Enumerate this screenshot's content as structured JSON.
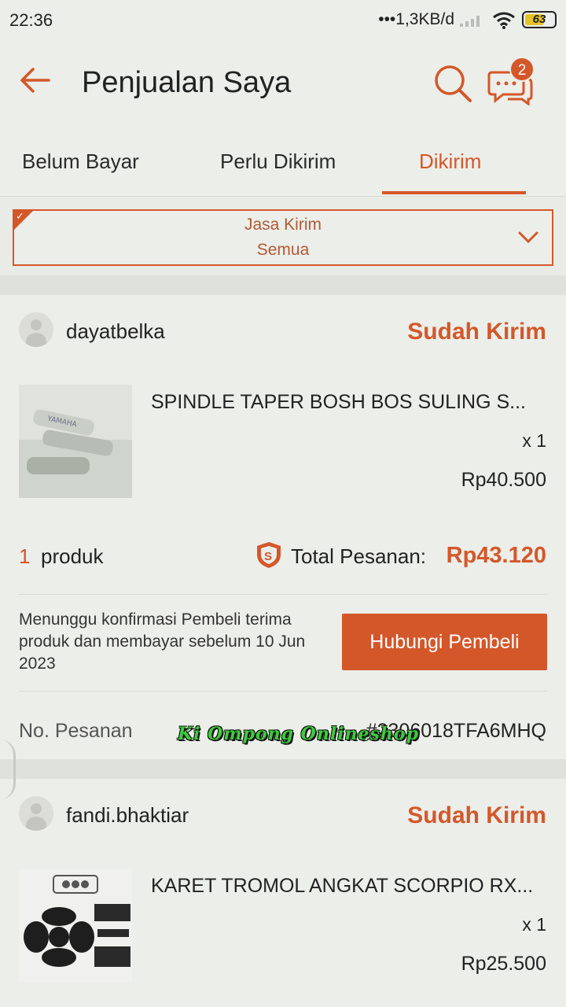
{
  "status_bar": {
    "time": "22:36",
    "network": "•••1,3KB/d",
    "battery": "63"
  },
  "header": {
    "title": "Penjualan Saya",
    "chat_badge": "2"
  },
  "tabs": [
    {
      "label": "Belum Bayar"
    },
    {
      "label": "Perlu Dikirim"
    },
    {
      "label": "Dikirim",
      "active": true
    }
  ],
  "filter": {
    "label": "Jasa Kirim",
    "value": "Semua"
  },
  "orders": [
    {
      "buyer": "dayatbelka",
      "status": "Sudah Kirim",
      "product_name": "SPINDLE TAPER BOSH BOS SULING S...",
      "quantity": "x 1",
      "price": "Rp40.500",
      "product_count": "1",
      "product_count_label": "produk",
      "total_label": "Total Pesanan:",
      "total": "Rp43.120",
      "note": "Menunggu konfirmasi Pembeli terima produk dan membayar sebelum 10 Jun 2023",
      "action": "Hubungi Pembeli",
      "order_label": "No. Pesanan",
      "order_number": "#2306018TFA6MHQ"
    },
    {
      "buyer": "fandi.bhaktiar",
      "status": "Sudah Kirim",
      "product_name": "KARET TROMOL ANGKAT SCORPIO RX...",
      "quantity": "x 1",
      "price": "Rp25.500"
    }
  ],
  "watermark": "Ki Ompong Onlineshop",
  "colors": {
    "accent": "#d4572a",
    "background": "#eceee9",
    "separator": "#dfe2dc"
  }
}
